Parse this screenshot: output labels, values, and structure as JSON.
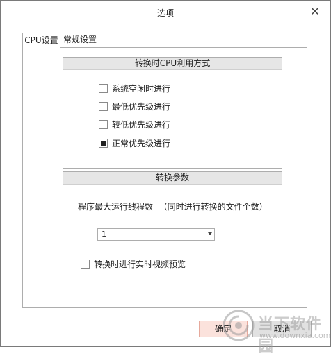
{
  "window": {
    "title": "选项",
    "close_glyph": "✕"
  },
  "tabs": [
    {
      "label": "CPU设置",
      "active": true
    },
    {
      "label": "常规设置",
      "active": false
    }
  ],
  "cpu_group": {
    "header": "转换时CPU利用方式",
    "options": [
      {
        "label": "系统空闲时进行",
        "checked": false
      },
      {
        "label": "最低优先级进行",
        "checked": false
      },
      {
        "label": "较低优先级进行",
        "checked": false
      },
      {
        "label": "正常优先级进行",
        "checked": true
      }
    ]
  },
  "param_group": {
    "header": "转换参数",
    "thread_label": "程序最大运行线程数--（同时进行转换的文件个数）",
    "thread_select_value": "1",
    "preview_label": "转换时进行实时视频预览",
    "preview_checked": false
  },
  "buttons": {
    "ok": "确定",
    "cancel": "取消"
  },
  "watermark": {
    "text": "当下软件园",
    "url": "www.downxia.com"
  }
}
